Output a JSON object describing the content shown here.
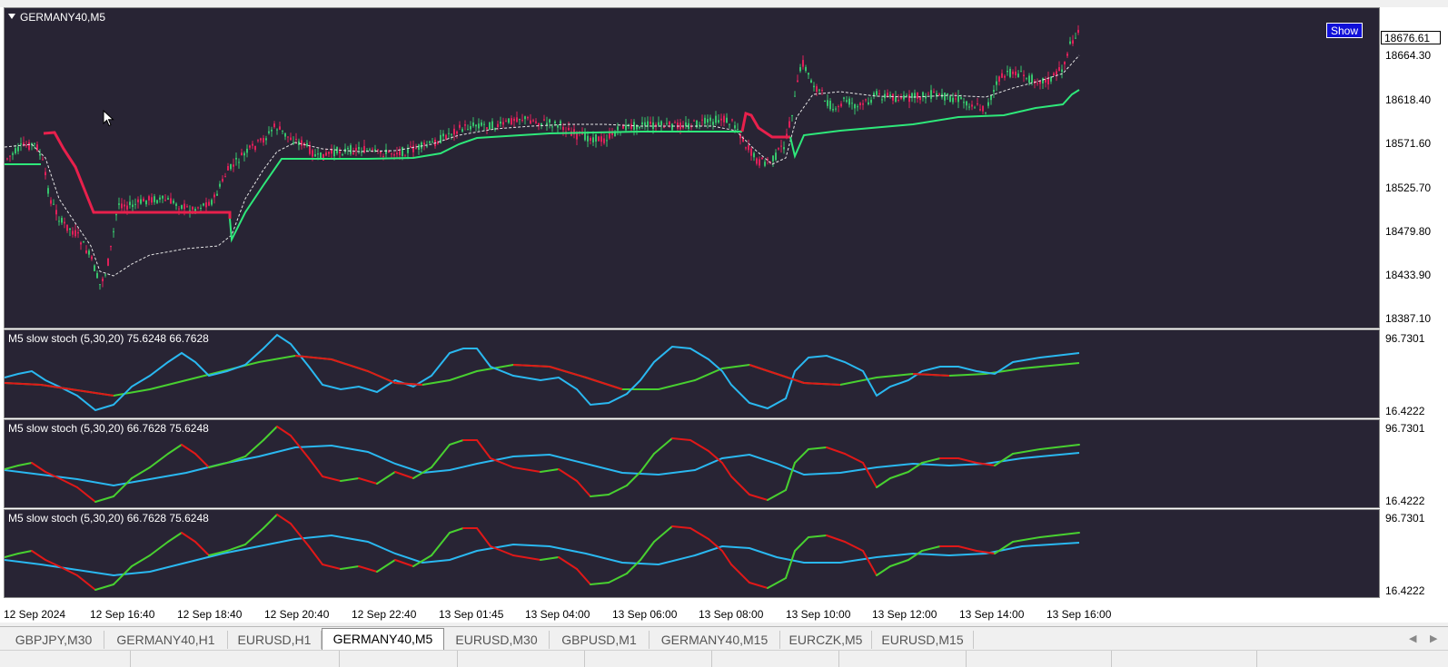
{
  "symbol_title": "GERMANY40,M5",
  "show_button": "Show",
  "current_price": "18676.61",
  "price_labels": [
    "18664.30",
    "18618.40",
    "18571.60",
    "18525.70",
    "18479.80",
    "18433.90",
    "18387.10"
  ],
  "oscillators": [
    {
      "title": "M5 slow stoch (5,30,20) 75.6248 66.7628",
      "max": "96.7301",
      "min": "16.4222"
    },
    {
      "title": "M5 slow stoch (5,30,20) 66.7628 75.6248",
      "max": "96.7301",
      "min": "16.4222"
    },
    {
      "title": "M5 slow stoch (5,30,20) 66.7628 75.6248",
      "max": "96.7301",
      "min": "16.4222"
    }
  ],
  "time_labels": [
    "12 Sep 2024",
    "12 Sep 16:40",
    "12 Sep 18:40",
    "12 Sep 20:40",
    "12 Sep 22:40",
    "13 Sep 01:45",
    "13 Sep 04:00",
    "13 Sep 06:00",
    "13 Sep 08:00",
    "13 Sep 10:00",
    "13 Sep 12:00",
    "13 Sep 14:00",
    "13 Sep 16:00"
  ],
  "tabs": [
    {
      "label": "GBPJPY,M30",
      "active": false
    },
    {
      "label": "GERMANY40,H1",
      "active": false
    },
    {
      "label": "EURUSD,H1",
      "active": false
    },
    {
      "label": "GERMANY40,M5",
      "active": true
    },
    {
      "label": "EURUSD,M30",
      "active": false
    },
    {
      "label": "GBPUSD,M1",
      "active": false
    },
    {
      "label": "GERMANY40,M15",
      "active": false
    },
    {
      "label": "EURCZK,M5",
      "active": false
    },
    {
      "label": "EURUSD,M15",
      "active": false
    }
  ],
  "colors": {
    "background": "#282434",
    "bull_candle": "#36c46c",
    "bear_candle": "#e0205a",
    "trail_up": "#2ee87a",
    "trail_down": "#e8204c",
    "stoch_main": "#2ab8f0",
    "stoch_signal_up": "#48d030",
    "stoch_signal_down": "#e01818"
  },
  "icons": {
    "tab_scroll_left": "chevron-left-icon",
    "tab_scroll_right": "chevron-right-icon",
    "cursor": "mouse-pointer-icon"
  }
}
